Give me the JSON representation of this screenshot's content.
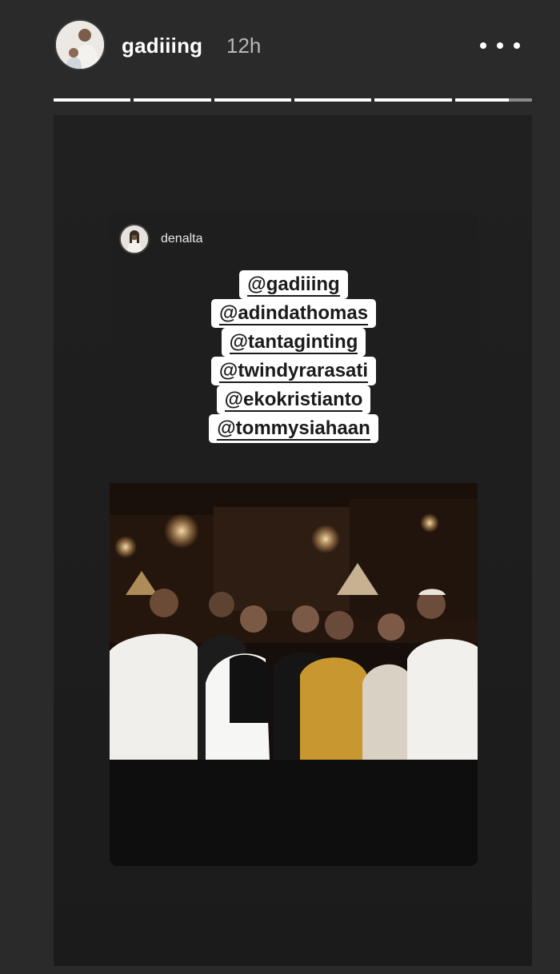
{
  "header": {
    "username": "gadiiing",
    "timestamp": "12h",
    "avatar_icon": "profile-avatar",
    "more_icon": "more-options-icon",
    "progress": [
      1,
      1,
      1,
      1,
      1,
      0.7
    ]
  },
  "card": {
    "username": "denalta",
    "avatar_icon": "profile-avatar",
    "mentions": [
      "@gadiiing",
      "@adindathomas",
      "@tantaginting",
      "@twindyrarasati",
      "@ekokristianto",
      "@tommysiahaan"
    ],
    "photo_icon": "group-photo"
  },
  "colors": {
    "background": "#2a2a2a",
    "story": "#1e1e1e",
    "card": "#111111",
    "sticker": "#ffffff"
  }
}
